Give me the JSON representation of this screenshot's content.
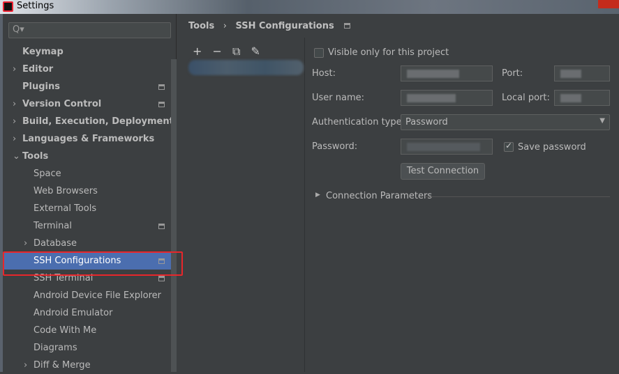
{
  "window": {
    "title": "Settings"
  },
  "search": {
    "placeholder": "Q▾"
  },
  "sidebar": {
    "items": [
      {
        "label": "Keymap",
        "bold": true,
        "arrow": "",
        "indent": 0,
        "proj": false
      },
      {
        "label": "Editor",
        "bold": true,
        "arrow": "›",
        "indent": 0,
        "proj": false
      },
      {
        "label": "Plugins",
        "bold": true,
        "arrow": "",
        "indent": 0,
        "proj": true
      },
      {
        "label": "Version Control",
        "bold": true,
        "arrow": "›",
        "indent": 0,
        "proj": true
      },
      {
        "label": "Build, Execution, Deployment",
        "bold": true,
        "arrow": "›",
        "indent": 0,
        "proj": false
      },
      {
        "label": "Languages & Frameworks",
        "bold": true,
        "arrow": "›",
        "indent": 0,
        "proj": false
      },
      {
        "label": "Tools",
        "bold": true,
        "arrow": "⌄",
        "indent": 0,
        "proj": false
      },
      {
        "label": "Space",
        "bold": false,
        "arrow": "",
        "indent": 1,
        "proj": false
      },
      {
        "label": "Web Browsers",
        "bold": false,
        "arrow": "",
        "indent": 1,
        "proj": false
      },
      {
        "label": "External Tools",
        "bold": false,
        "arrow": "",
        "indent": 1,
        "proj": false
      },
      {
        "label": "Terminal",
        "bold": false,
        "arrow": "",
        "indent": 1,
        "proj": true
      },
      {
        "label": "Database",
        "bold": false,
        "arrow": "›",
        "indent": 1,
        "proj": false
      },
      {
        "label": "SSH Configurations",
        "bold": false,
        "arrow": "",
        "indent": 1,
        "proj": true,
        "selected": true
      },
      {
        "label": "SSH Terminal",
        "bold": false,
        "arrow": "",
        "indent": 1,
        "proj": true
      },
      {
        "label": "Android Device File Explorer",
        "bold": false,
        "arrow": "",
        "indent": 1,
        "proj": false
      },
      {
        "label": "Android Emulator",
        "bold": false,
        "arrow": "",
        "indent": 1,
        "proj": false
      },
      {
        "label": "Code With Me",
        "bold": false,
        "arrow": "",
        "indent": 1,
        "proj": false
      },
      {
        "label": "Diagrams",
        "bold": false,
        "arrow": "",
        "indent": 1,
        "proj": false
      },
      {
        "label": "Diff & Merge",
        "bold": false,
        "arrow": "›",
        "indent": 1,
        "proj": false
      }
    ]
  },
  "breadcrumb": {
    "parent": "Tools",
    "sep": "›",
    "current": "SSH Configurations"
  },
  "toolbar": {
    "add": "+",
    "remove": "−",
    "copy": "⧉",
    "edit": "✎"
  },
  "form": {
    "visible_only": "Visible only for this project",
    "visible_checked": false,
    "host_label": "Host:",
    "port_label": "Port:",
    "user_label": "User name:",
    "local_port_label": "Local port:",
    "auth_label": "Authentication type:",
    "auth_value": "Password",
    "password_label": "Password:",
    "save_password": "Save password",
    "save_checked": true,
    "test_button": "Test Connection",
    "conn_params": "Connection Parameters"
  },
  "colors": {
    "selection": "#4b6eaf",
    "highlight_box": "#e8262b"
  }
}
